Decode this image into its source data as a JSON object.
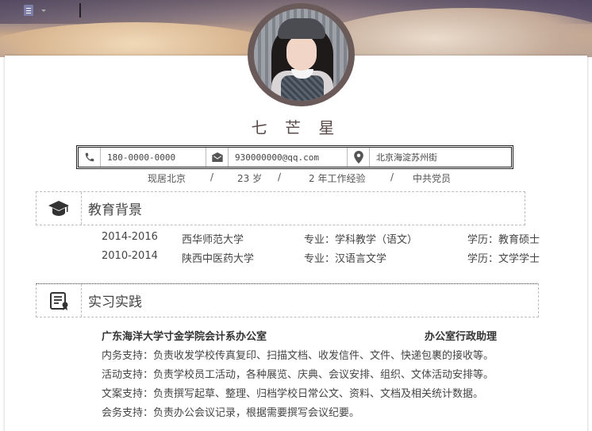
{
  "profile": {
    "name": "七 芒 星"
  },
  "contact": {
    "phone": "180-0000-0000",
    "email": "930000000@qq.com",
    "address": "北京海淀苏州街"
  },
  "meta": {
    "location": "现居北京",
    "sep": "/",
    "age": "23 岁",
    "experience": "2 年工作经验",
    "politics": "中共党员"
  },
  "education": {
    "title": "教育背景",
    "rows": [
      {
        "period": "2014-2016",
        "school": "西华师范大学",
        "major": "专业：学科教学（语文）",
        "degree": "学历：教育硕士"
      },
      {
        "period": "2010-2014",
        "school": "陕西中医药大学",
        "major": "专业：汉语言文学",
        "degree": "学历：文学学士"
      }
    ]
  },
  "internship": {
    "title": "实习实践",
    "org": "广东海洋大学寸金学院会计系办公室",
    "role": "办公室行政助理",
    "duties": [
      "内务支持：负责收发学校传真复印、扫描文档、收发信件、文件、快递包裹的接收等。",
      "活动支持：负责学校员工活动，各种展览、庆典、会议安排、组织、文体活动安排等。",
      "文案支持：负责撰写起草、整理、归档学校日常公文、资料、文档及相关统计数据。",
      "会务支持：负责办公会议记录，根据需要撰写会议纪要。"
    ]
  },
  "icons": {
    "phone": "phone-icon",
    "email": "envelope-icon",
    "address": "location-pin-icon",
    "education": "graduation-cap-icon",
    "internship": "certificate-icon"
  },
  "colors": {
    "name_text": "#5a4a4a",
    "avatar_ring": "#6b5a5a",
    "icon_dark": "#333333"
  }
}
